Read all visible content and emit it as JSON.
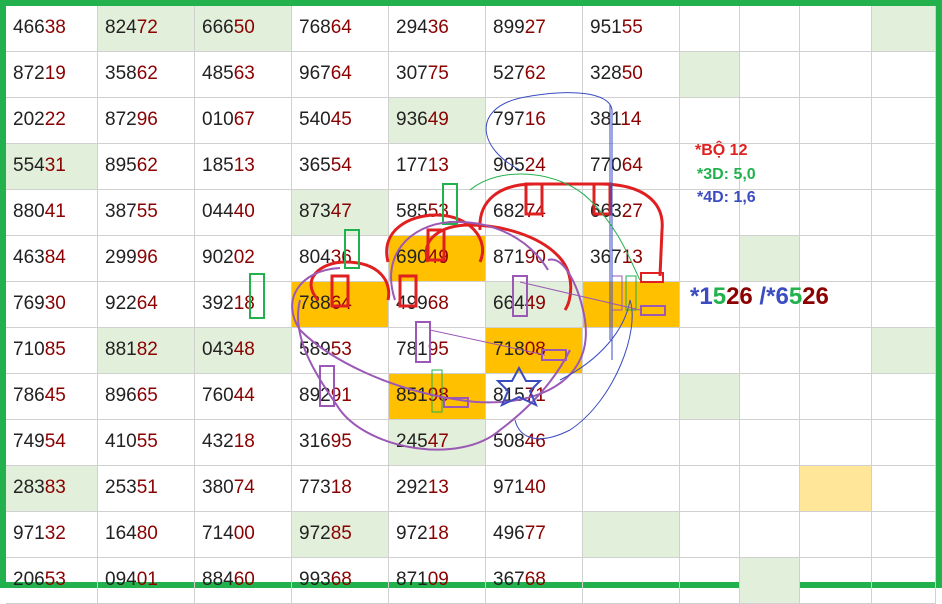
{
  "table": {
    "rows": [
      [
        "46638",
        "82472",
        "66650",
        "76864",
        "29436",
        "89927",
        "95155"
      ],
      [
        "87219",
        "35862",
        "48563",
        "96764",
        "30775",
        "52762",
        "32850"
      ],
      [
        "20222",
        "87296",
        "01067",
        "54045",
        "93649",
        "79716",
        "38114"
      ],
      [
        "55431",
        "89562",
        "18513",
        "36554",
        "17713",
        "90524",
        "77064"
      ],
      [
        "88041",
        "38755",
        "04440",
        "87347",
        "58553",
        "68274",
        "66327"
      ],
      [
        "46384",
        "29996",
        "90202",
        "80436",
        "69049",
        "87190",
        "36713"
      ],
      [
        "76930",
        "92264",
        "39218",
        "78864",
        "49968",
        "66449",
        ""
      ],
      [
        "71085",
        "88182",
        "04348",
        "58953",
        "78195",
        "71808",
        ""
      ],
      [
        "78645",
        "89665",
        "76044",
        "89291",
        "85198",
        "81571",
        ""
      ],
      [
        "74954",
        "41055",
        "43218",
        "31695",
        "24547",
        "50846",
        ""
      ],
      [
        "28383",
        "25351",
        "38074",
        "77318",
        "29213",
        "97140",
        ""
      ],
      [
        "97132",
        "16480",
        "71400",
        "97285",
        "97218",
        "49677",
        ""
      ],
      [
        "20653",
        "09401",
        "88460",
        "99368",
        "87109",
        "36768",
        ""
      ]
    ],
    "shading": [
      [
        "",
        "g",
        "g",
        "",
        "",
        "",
        "",
        "",
        "",
        "",
        "g"
      ],
      [
        "",
        "",
        "",
        "",
        "",
        "",
        "",
        "g",
        "",
        "",
        ""
      ],
      [
        "",
        "",
        "",
        "",
        "g",
        "",
        "",
        "",
        "",
        "",
        ""
      ],
      [
        "g",
        "",
        "",
        "",
        "",
        "",
        "",
        "",
        "",
        "",
        ""
      ],
      [
        "",
        "",
        "",
        "g",
        "",
        "",
        "",
        "",
        "",
        "",
        ""
      ],
      [
        "",
        "",
        "",
        "",
        "o",
        "",
        "",
        "",
        "g",
        "",
        ""
      ],
      [
        "",
        "",
        "",
        "o",
        "",
        "g",
        "o",
        "",
        "",
        "",
        ""
      ],
      [
        "",
        "g",
        "g",
        "",
        "",
        "o",
        "",
        "",
        "",
        "",
        "g"
      ],
      [
        "",
        "",
        "",
        "",
        "o",
        "",
        "",
        "g",
        "",
        "",
        ""
      ],
      [
        "",
        "",
        "",
        "",
        "g",
        "",
        "",
        "",
        "",
        "",
        ""
      ],
      [
        "g",
        "",
        "",
        "",
        "",
        "",
        "",
        "",
        "",
        "o",
        ""
      ],
      [
        "",
        "",
        "",
        "g",
        "",
        "",
        "g",
        "",
        "",
        "",
        ""
      ],
      [
        "",
        "",
        "",
        "",
        "",
        "",
        "",
        "",
        "g",
        "",
        ""
      ]
    ]
  },
  "side": {
    "bo": "*BỘ 12",
    "d3": "*3D: 5,0",
    "d4": "*4D: 1,6",
    "pair_star1": "*",
    "pair_a": "1",
    "pair_b": "5",
    "pair_c": "26",
    "pair_sep": " /*",
    "pair_d": "6",
    "pair_e": "5",
    "pair_f": "26"
  },
  "colors": {
    "border": "#22b14c",
    "green_cell": "#e2efda",
    "orange_cell": "#ffc000",
    "light_orange_cell": "#ffe699",
    "head_digits": "#222222",
    "tail_digits": "#8b0000",
    "bo": "#e02020",
    "d3": "#22b14c",
    "d4": "#3b4cc0",
    "pair_blue": "#3b4cc0",
    "pair_green": "#22b14c",
    "pair_red": "#8b0000",
    "mark_red": "#e02020",
    "mark_green": "#22b14c",
    "mark_purple": "#9b59b6",
    "mark_blue": "#3b4cc0"
  }
}
